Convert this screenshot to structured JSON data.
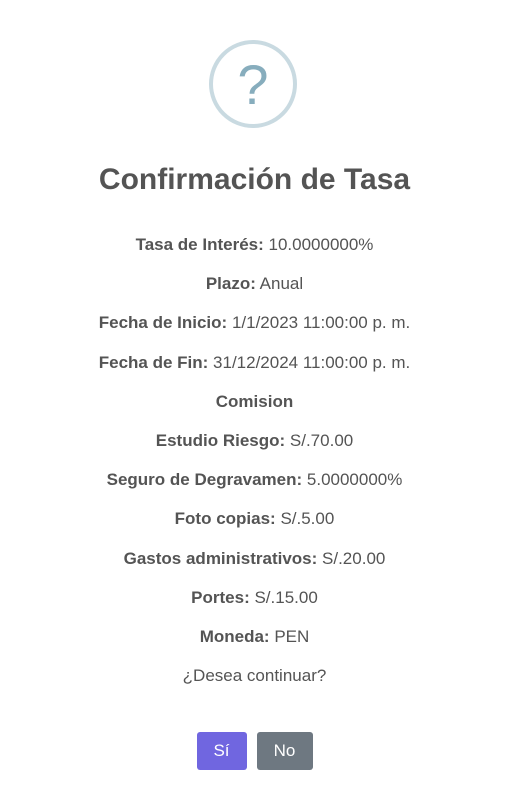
{
  "dialog": {
    "icon": "question-icon",
    "icon_glyph": "?",
    "title": "Confirmación de Tasa",
    "rows": [
      {
        "label": "Tasa de Interés:",
        "value": " 10.0000000%"
      },
      {
        "label": "Plazo:",
        "value": " Anual"
      },
      {
        "label": "Fecha de Inicio:",
        "value": " 1/1/2023 11:00:00 p. m."
      },
      {
        "label": "Fecha de Fin:",
        "value": " 31/12/2024 11:00:00 p. m."
      },
      {
        "label": "Comision",
        "value": ""
      },
      {
        "label": "Estudio Riesgo:",
        "value": " S/.70.00"
      },
      {
        "label": "Seguro de Degravamen:",
        "value": " 5.0000000%"
      },
      {
        "label": "Foto copias:",
        "value": " S/.5.00"
      },
      {
        "label": "Gastos administrativos:",
        "value": " S/.20.00"
      },
      {
        "label": "Portes:",
        "value": " S/.15.00"
      },
      {
        "label": "Moneda:",
        "value": " PEN"
      }
    ],
    "question": "¿Desea continuar?",
    "confirm_label": "Sí",
    "cancel_label": "No",
    "colors": {
      "confirm": "#7066e0",
      "cancel": "#6e7881",
      "icon_border": "#c9dae1",
      "icon_glyph": "#87adbd",
      "text": "#545454"
    }
  }
}
